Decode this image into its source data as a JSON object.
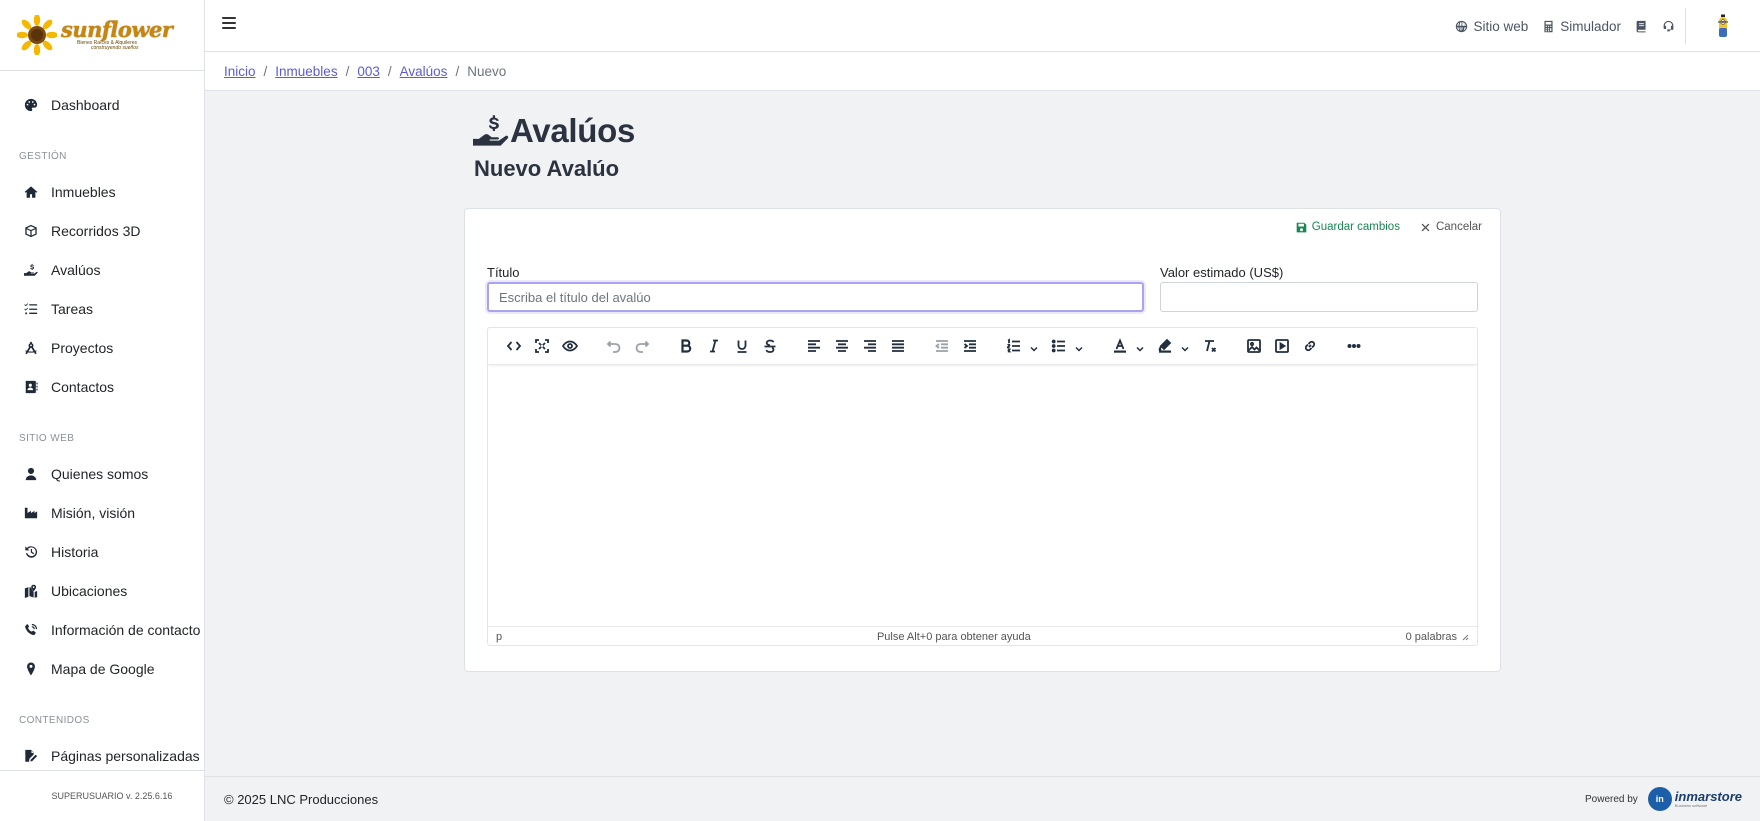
{
  "brand": {
    "logo_word": "sunflower",
    "logo_tag": "Bienes Raíces & Alquileres",
    "logo_tag2": "construyendo sueños"
  },
  "sidebar": {
    "items_main": [
      {
        "label": "Dashboard",
        "icon": "palette-icon"
      }
    ],
    "section_gestion": "GESTIÓN",
    "items_gestion": [
      {
        "label": "Inmuebles",
        "icon": "home-icon"
      },
      {
        "label": "Recorridos 3D",
        "icon": "cube-icon"
      },
      {
        "label": "Avalúos",
        "icon": "hand-dollar-icon"
      },
      {
        "label": "Tareas",
        "icon": "tasks-icon"
      },
      {
        "label": "Proyectos",
        "icon": "compass-icon"
      },
      {
        "label": "Contactos",
        "icon": "address-book-icon"
      }
    ],
    "section_sitio": "SITIO WEB",
    "items_sitio": [
      {
        "label": "Quienes somos",
        "icon": "user-icon"
      },
      {
        "label": "Misión, visión",
        "icon": "industry-icon"
      },
      {
        "label": "Historia",
        "icon": "history-icon"
      },
      {
        "label": "Ubicaciones",
        "icon": "map-location-icon"
      },
      {
        "label": "Información de contacto",
        "icon": "phone-icon"
      },
      {
        "label": "Mapa de Google",
        "icon": "map-pin-icon"
      }
    ],
    "section_contenidos": "CONTENIDOS",
    "items_contenidos": [
      {
        "label": "Páginas personalizadas",
        "icon": "file-edit-icon"
      }
    ],
    "footer": "SUPERUSUARIO v. 2.25.6.16"
  },
  "topbar": {
    "links": [
      {
        "label": "Sitio web",
        "icon": "globe-icon"
      },
      {
        "label": "Simulador",
        "icon": "calculator-icon"
      }
    ]
  },
  "breadcrumb": {
    "items": [
      "Inicio",
      "Inmuebles",
      "003",
      "Avalúos"
    ],
    "current": "Nuevo"
  },
  "page": {
    "title": "Avalúos",
    "subtitle": "Nuevo Avalúo"
  },
  "form": {
    "save_label": "Guardar cambios",
    "cancel_label": "Cancelar",
    "title_label": "Título",
    "title_placeholder": "Escriba el título del avalúo",
    "title_value": "",
    "value_label": "Valor estimado (US$)",
    "value_value": ""
  },
  "editor": {
    "status_path": "p",
    "status_help": "Pulse Alt+0 para obtener ayuda",
    "status_words": "0 palabras"
  },
  "footer": {
    "copyright": "© 2025 LNC Producciones",
    "powered_by": "Powered by",
    "inmar_badge": "in",
    "inmar_word": "inmarstore",
    "inmar_sub": "Business software"
  },
  "colors": {
    "link": "#5b5bd6",
    "save": "#198754",
    "focus_border": "#a9a3f0",
    "heading": "#2c3340"
  }
}
